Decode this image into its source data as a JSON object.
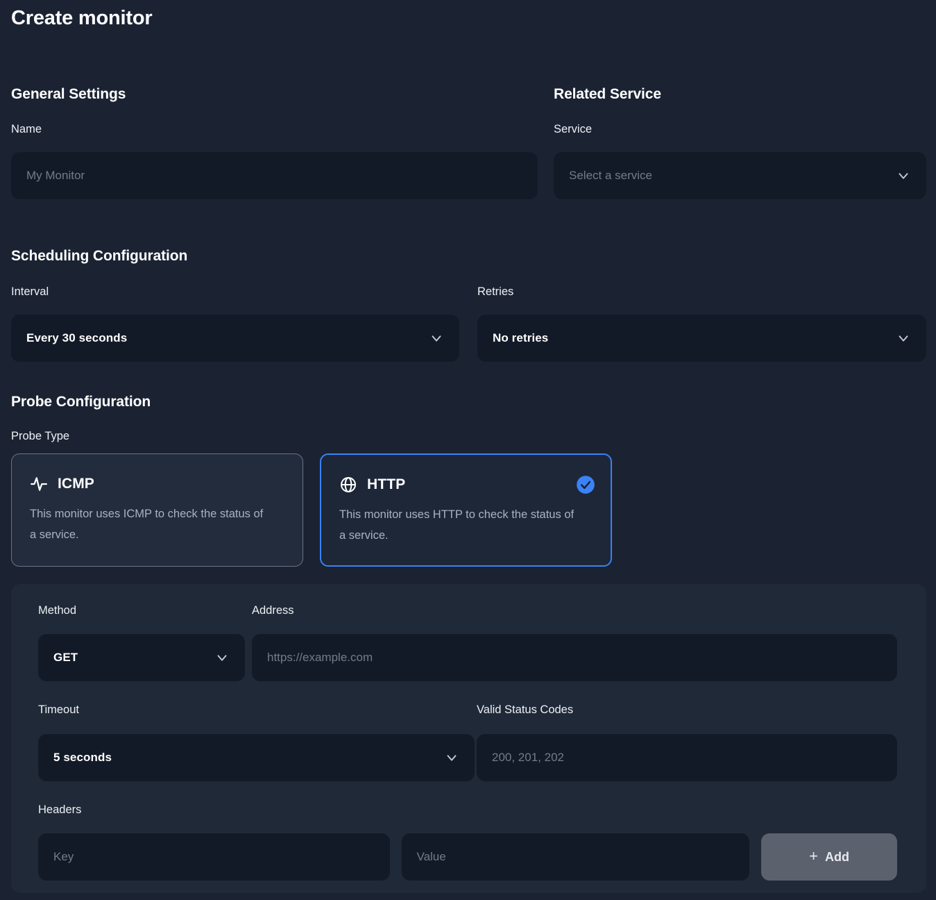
{
  "page": {
    "title": "Create monitor",
    "accent_color": "#3b82f6",
    "background_color": "#1b2333",
    "panel_color": "#1f2937",
    "input_color": "#131a27"
  },
  "general_settings": {
    "heading": "General Settings",
    "name": {
      "label": "Name",
      "value": "",
      "placeholder": "My Monitor"
    }
  },
  "related_service": {
    "heading": "Related Service",
    "service": {
      "label": "Service",
      "value": "",
      "placeholder": "Select a service"
    }
  },
  "scheduling": {
    "heading": "Scheduling Configuration",
    "interval": {
      "label": "Interval",
      "value": "Every 30 seconds"
    },
    "retries": {
      "label": "Retries",
      "value": "No retries"
    }
  },
  "probe": {
    "heading": "Probe Configuration",
    "type_label": "Probe Type",
    "cards": [
      {
        "id": "icmp",
        "icon": "activity-pulse-icon",
        "title": "ICMP",
        "description": "This monitor uses ICMP to check the status of a service.",
        "selected": false
      },
      {
        "id": "http",
        "icon": "globe-icon",
        "title": "HTTP",
        "description": "This monitor uses HTTP to check the status of a service.",
        "selected": true
      }
    ]
  },
  "http_settings": {
    "method": {
      "label": "Method",
      "value": "GET"
    },
    "address": {
      "label": "Address",
      "value": "",
      "placeholder": "https://example.com"
    },
    "timeout": {
      "label": "Timeout",
      "value": "5 seconds"
    },
    "status_codes": {
      "label": "Valid Status Codes",
      "value": "",
      "placeholder": "200, 201, 202"
    },
    "headers": {
      "label": "Headers",
      "key_placeholder": "Key",
      "value_placeholder": "Value",
      "key_value": "",
      "value_value": "",
      "add_label": "Add",
      "add_icon": "plus-icon"
    }
  }
}
